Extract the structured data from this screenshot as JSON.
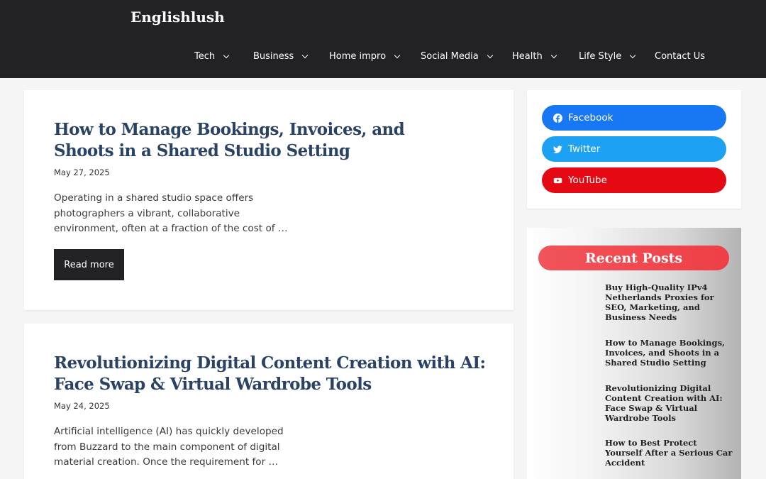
{
  "site": {
    "title": "Englishlush"
  },
  "nav": [
    {
      "label": "Tech",
      "has_dropdown": true
    },
    {
      "label": "Business",
      "has_dropdown": true
    },
    {
      "label": "Home impro",
      "has_dropdown": true
    },
    {
      "label": "Social Media",
      "has_dropdown": true
    },
    {
      "label": "Health",
      "has_dropdown": true
    },
    {
      "label": "Life Style",
      "has_dropdown": true
    },
    {
      "label": "Contact Us",
      "has_dropdown": false
    }
  ],
  "posts": [
    {
      "title": "How to Manage Bookings, Invoices, and Shoots in a Shared Studio Setting",
      "date": "May 27, 2025",
      "excerpt": "Operating in a shared studio space offers photographers a vibrant, collaborative environment, often at a fraction of the cost of …",
      "read_more": "Read more"
    },
    {
      "title": "Revolutionizing Digital Content Creation with AI: Face Swap & Virtual Wardrobe Tools",
      "date": "May 24, 2025",
      "excerpt": "Artificial intelligence (AI) has quickly developed from Buzzard to the main component of digital material creation. Once the requirement for …"
    }
  ],
  "social": [
    {
      "label": "Facebook",
      "icon": "facebook-icon",
      "color": "#1877f2"
    },
    {
      "label": "Twitter",
      "icon": "twitter-icon",
      "color": "#1da1f2"
    },
    {
      "label": "YouTube",
      "icon": "youtube-icon",
      "color": "#e50914"
    }
  ],
  "recent": {
    "heading": "Recent Posts",
    "items": [
      "Buy High-Quality IPv4 Netherlands Proxies for SEO, Marketing, and Business Needs",
      "How to Manage Bookings, Invoices, and Shoots in a Shared Studio Setting",
      "Revolutionizing Digital Content Creation with AI: Face Swap & Virtual Wardrobe Tools",
      "How to Best Protect Yourself After a Serious Car Accident"
    ]
  },
  "colors": {
    "header_bg": "#222126",
    "title_blue": "#2a4263",
    "accent_red": "#ee3f46"
  }
}
